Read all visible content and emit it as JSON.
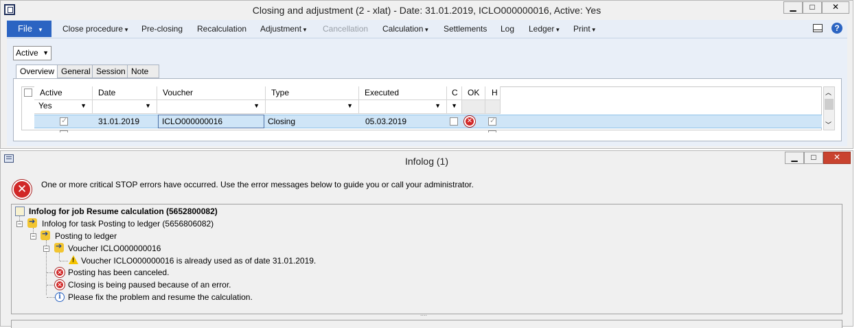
{
  "main_window": {
    "title": "Closing and adjustment (2 - xlat) - Date: 31.01.2019, ICLO000000016, Active: Yes",
    "controls": {
      "minimize": "▁",
      "maximize": "□",
      "close": "✕"
    },
    "menu": {
      "file": "File",
      "items": [
        {
          "label": "Close procedure",
          "dropdown": true,
          "disabled": false
        },
        {
          "label": "Pre-closing",
          "dropdown": false,
          "disabled": false
        },
        {
          "label": "Recalculation",
          "dropdown": false,
          "disabled": false
        },
        {
          "label": "Adjustment",
          "dropdown": true,
          "disabled": false
        },
        {
          "label": "Cancellation",
          "dropdown": false,
          "disabled": true
        },
        {
          "label": "Calculation",
          "dropdown": true,
          "disabled": false
        },
        {
          "label": "Settlements",
          "dropdown": false,
          "disabled": false
        },
        {
          "label": "Log",
          "dropdown": false,
          "disabled": false
        },
        {
          "label": "Ledger",
          "dropdown": true,
          "disabled": false
        },
        {
          "label": "Print",
          "dropdown": true,
          "disabled": false
        }
      ]
    },
    "filter_select": "Active",
    "tabs": [
      "Overview",
      "General",
      "Session",
      "Note"
    ],
    "grid": {
      "headers": {
        "active": "Active",
        "date": "Date",
        "voucher": "Voucher",
        "type": "Type",
        "executed": "Executed",
        "c": "C",
        "ok": "OK",
        "h": "H"
      },
      "filter_active": "Yes",
      "row": {
        "date": "31.01.2019",
        "voucher": "ICLO000000016",
        "type": "Closing",
        "executed": "05.03.2019",
        "active_checked": true,
        "c_checked": false,
        "h_checked": true
      }
    }
  },
  "infolog": {
    "title": "Infolog (1)",
    "message": "One or more critical STOP errors have occurred. Use the error messages below to guide you or call your administrator.",
    "tree": [
      {
        "text": "Infolog for job Resume calculation (5652800082)",
        "level": 0,
        "icon": "job-icon",
        "bold": true
      },
      {
        "text": "Infolog for task Posting to ledger (5656806082)",
        "level": 1,
        "icon": "task-arrow-icon"
      },
      {
        "text": "Posting to ledger",
        "level": 2,
        "icon": "task-arrow-icon"
      },
      {
        "text": "Voucher ICLO000000016",
        "level": 3,
        "icon": "task-arrow-icon"
      },
      {
        "text": "Voucher ICLO000000016 is already used as of date 31.01.2019.",
        "level": 4,
        "icon": "warning-icon"
      },
      {
        "text": "Posting has been canceled.",
        "level": 3,
        "icon": "error-icon"
      },
      {
        "text": "Closing is being paused because of an error.",
        "level": 3,
        "icon": "error-icon"
      },
      {
        "text": "Please fix the problem and resume the calculation.",
        "level": 3,
        "icon": "info-icon"
      }
    ],
    "splitter": "....",
    "colors": {
      "error": "#d12727",
      "accent": "#2b64c2"
    }
  }
}
